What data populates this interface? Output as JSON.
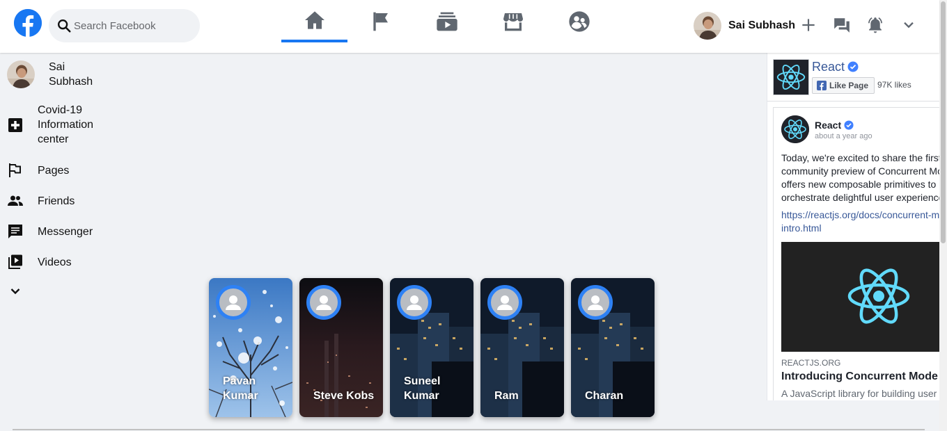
{
  "header": {
    "search_placeholder": "Search Facebook",
    "user_name": "Sai Subhash",
    "nav": [
      "home-icon",
      "flag-icon",
      "watch-icon",
      "marketplace-icon",
      "groups-icon"
    ],
    "accent": "#1877f2"
  },
  "sidebar": {
    "profile_line1": "Sai",
    "profile_line2": "Subhash",
    "items": [
      {
        "icon": "plus-icon",
        "l1": "Covid-19",
        "l2": "Information",
        "l3": "center"
      },
      {
        "icon": "flag-icon",
        "label": "Pages"
      },
      {
        "icon": "people-icon",
        "label": "Friends"
      },
      {
        "icon": "chat-icon",
        "label": "Messenger"
      },
      {
        "icon": "video-icon",
        "label": "Videos"
      }
    ]
  },
  "stories": [
    {
      "name": "Pavan Kumar"
    },
    {
      "name": "Steve Kobs"
    },
    {
      "name": "Suneel Kumar"
    },
    {
      "name": "Ram"
    },
    {
      "name": "Charan"
    }
  ],
  "widget": {
    "page_name": "React",
    "like_label": "Like Page",
    "likes": "97K likes",
    "post": {
      "author": "React",
      "time": "about a year ago",
      "text_lines": [
        "Today, we're excited to share the first",
        "community preview of Concurrent Mo",
        "offers new composable primitives to h",
        "orchestrate delightful user experience"
      ],
      "link_lines": [
        "https://reactjs.org/docs/concurrent-m",
        "intro.html"
      ],
      "domain": "REACTJS.ORG",
      "headline": "Introducing Concurrent Mode",
      "description": "A JavaScript library for building user"
    },
    "react_color": "#61dafb"
  }
}
